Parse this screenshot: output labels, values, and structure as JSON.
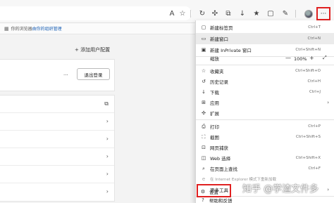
{
  "toolbar": {
    "icons": [
      "read-aloud-icon",
      "favorite-star-icon",
      "refresh-icon",
      "extensions-icon",
      "collections-icon",
      "downloads-icon",
      "favorites-bar-icon",
      "pen-icon",
      "profile-avatar",
      "more-icon"
    ]
  },
  "managed_bar": {
    "text": "你的浏览器",
    "link": "由你的组织管理"
  },
  "settings_page": {
    "add_profile": "+ 添加用户配置",
    "more_dots": "···",
    "signout": "退出登录",
    "rows_count_note": ""
  },
  "menu": {
    "items": [
      {
        "icon": "▢",
        "label": "新建标签页",
        "shortcut": "Ctrl+T"
      },
      {
        "icon": "▭",
        "label": "新建窗口",
        "shortcut": "Ctrl+N"
      },
      {
        "icon": "▣",
        "label": "新建 InPrivate 窗口",
        "shortcut": "Ctrl+Shift+N"
      },
      {
        "label": "缩放",
        "zoom": "100%"
      },
      {
        "icon": "☆",
        "label": "收藏夹",
        "shortcut": "Ctrl+Shift+O"
      },
      {
        "icon": "↺",
        "label": "历史记录",
        "shortcut": "Ctrl+H"
      },
      {
        "icon": "↓",
        "label": "下载",
        "shortcut": "Ctrl+J"
      },
      {
        "icon": "⊞",
        "label": "应用"
      },
      {
        "icon": "✣",
        "label": "扩展"
      },
      {
        "icon": "⎙",
        "label": "打印",
        "shortcut": "Ctrl+P"
      },
      {
        "icon": "⛶",
        "label": "截图",
        "shortcut": "Ctrl+Shift+S"
      },
      {
        "icon": "⊡",
        "label": "网页捕获",
        "shortcut": "Ctrl+Shift+S"
      },
      {
        "icon": "◫",
        "label": "Web 选择",
        "shortcut": "Ctrl+Shift+X"
      },
      {
        "icon": "⌕",
        "label": "在页面上查找",
        "shortcut": "Ctrl+F"
      },
      {
        "icon": "e",
        "label": "在 Internet Explorer 模式下重新加载"
      },
      {
        "label": "更多工具"
      },
      {
        "icon": "⚙",
        "label": "设置"
      },
      {
        "icon": "?",
        "label": "帮助和反馈"
      }
    ]
  },
  "watermark": "知乎 @学渣文件多"
}
